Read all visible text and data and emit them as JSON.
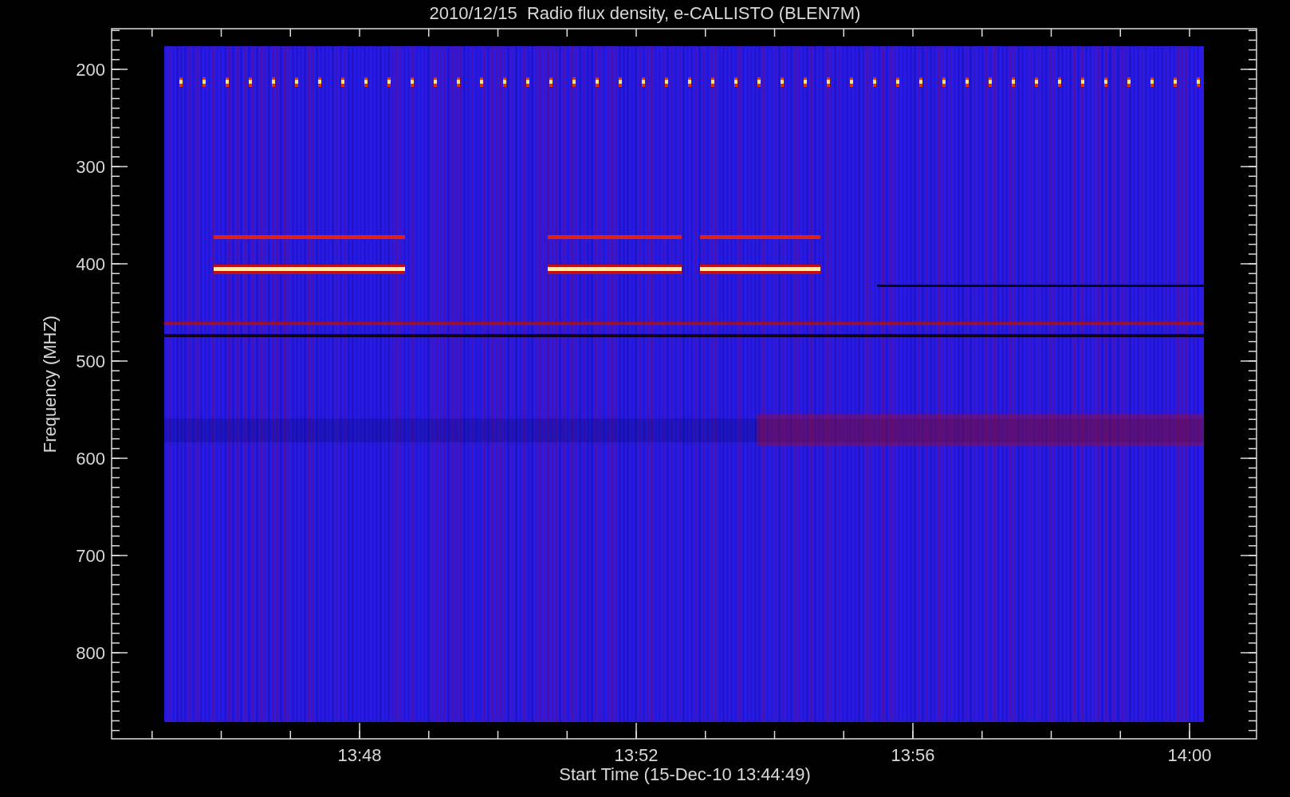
{
  "title": "2010/12/15  Radio flux density, e-CALLISTO (BLEN7M)",
  "y_axis": {
    "label": "Frequency (MHZ)",
    "ticks": [
      "200",
      "300",
      "400",
      "500",
      "600",
      "700",
      "800"
    ]
  },
  "x_axis": {
    "label": "Start Time (15-Dec-10 13:44:49)",
    "ticks": [
      "13:48",
      "13:52",
      "13:56",
      "14:00"
    ]
  }
}
